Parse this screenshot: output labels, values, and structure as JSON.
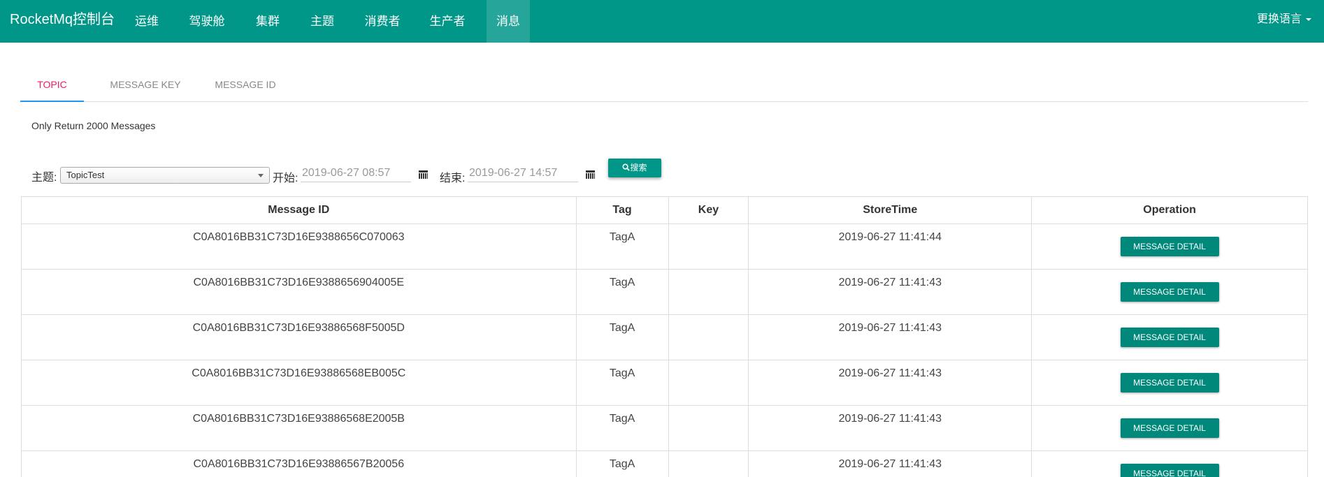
{
  "navbar": {
    "brand": "RocketMq控制台",
    "items": [
      "运维",
      "驾驶舱",
      "集群",
      "主题",
      "消费者",
      "生产者",
      "消息"
    ],
    "active_index": 6,
    "language_label": "更换语言"
  },
  "tabs": {
    "items": [
      "TOPIC",
      "MESSAGE KEY",
      "MESSAGE ID"
    ],
    "active_index": 0
  },
  "info_text": "Only Return 2000 Messages",
  "search": {
    "topic_label": "主题:",
    "topic_value": "TopicTest",
    "begin_label": "开始:",
    "begin_value": "2019-06-27 08:57",
    "end_label": "结束:",
    "end_value": "2019-06-27 14:57",
    "search_button": "搜索"
  },
  "table": {
    "headers": [
      "Message ID",
      "Tag",
      "Key",
      "StoreTime",
      "Operation"
    ],
    "detail_button": "MESSAGE DETAIL",
    "rows": [
      {
        "id": "C0A8016BB31C73D16E9388656C070063",
        "tag": "TagA",
        "key": "",
        "time": "2019-06-27 11:41:44"
      },
      {
        "id": "C0A8016BB31C73D16E9388656904005E",
        "tag": "TagA",
        "key": "",
        "time": "2019-06-27 11:41:43"
      },
      {
        "id": "C0A8016BB31C73D16E93886568F5005D",
        "tag": "TagA",
        "key": "",
        "time": "2019-06-27 11:41:43"
      },
      {
        "id": "C0A8016BB31C73D16E93886568EB005C",
        "tag": "TagA",
        "key": "",
        "time": "2019-06-27 11:41:43"
      },
      {
        "id": "C0A8016BB31C73D16E93886568E2005B",
        "tag": "TagA",
        "key": "",
        "time": "2019-06-27 11:41:43"
      },
      {
        "id": "C0A8016BB31C73D16E93886567B20056",
        "tag": "TagA",
        "key": "",
        "time": "2019-06-27 11:41:43"
      }
    ]
  },
  "colors": {
    "primary": "#009688",
    "nav_active": "#26a69a",
    "tab_active_text": "#e91e63",
    "tab_active_underline": "#2196f3"
  }
}
